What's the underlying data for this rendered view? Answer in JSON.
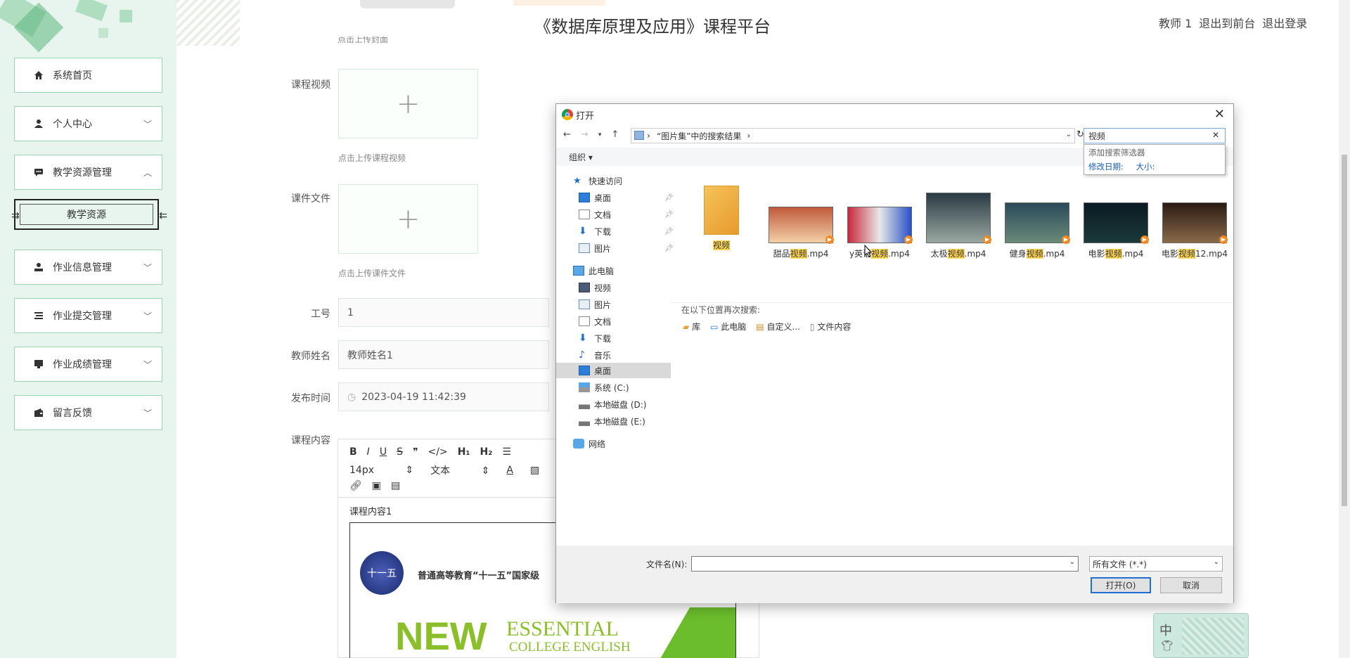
{
  "header": {
    "title": "《数据库原理及应用》课程平台",
    "user": "教师 1",
    "back_front": "退出到前台",
    "logout": "退出登录"
  },
  "sidebar": {
    "items": [
      {
        "label": "系统首页",
        "icon": "home-icon"
      },
      {
        "label": "个人中心",
        "icon": "person-icon"
      },
      {
        "label": "教学资源管理",
        "icon": "chat-icon",
        "expanded": true
      },
      {
        "label": "作业信息管理",
        "icon": "person-icon"
      },
      {
        "label": "作业提交管理",
        "icon": "list-icon"
      },
      {
        "label": "作业成绩管理",
        "icon": "monitor-icon"
      },
      {
        "label": "留言反馈",
        "icon": "wallet-icon"
      }
    ],
    "sub_item": "教学资源"
  },
  "form": {
    "video_label": "课程视频",
    "video_hint": "点击上传课程视频",
    "file_label": "课件文件",
    "file_hint": "点击上传课件文件",
    "id_label": "工号",
    "id_value": "1",
    "name_label": "教师姓名",
    "name_value": "教师姓名1",
    "time_label": "发布时间",
    "time_value": "2023-04-19 11:42:39",
    "content_label": "课程内容",
    "top_hint": "点击上传封面"
  },
  "editor": {
    "font_size": "14px",
    "block_type": "文本",
    "content_text": "课程内容1",
    "banner_text": "普通高等教育“十一五”国家级",
    "banner_badge": "十一五",
    "book_big": "NEW",
    "book_line1": "ESSENTIAL",
    "book_line2": "COLLEGE ENGLISH"
  },
  "dialog": {
    "title": "打开",
    "address": "“图片集”中的搜索结果",
    "search_value": "视频",
    "search_hint": "添加搜索筛选器",
    "filter_date": "修改日期:",
    "filter_size": "大小:",
    "organize": "组织",
    "nav": [
      "快速访问",
      "桌面",
      "文档",
      "下载",
      "图片",
      "此电脑",
      "视频",
      "图片",
      "文档",
      "下载",
      "音乐",
      "桌面",
      "系统 (C:)",
      "本地磁盘 (D:)",
      "本地磁盘 (E:)",
      "网络"
    ],
    "files": [
      {
        "pre": "",
        "hl": "视频",
        "post": ""
      },
      {
        "pre": "甜品",
        "hl": "视频",
        "post": ".mp4"
      },
      {
        "pre": "y英语",
        "hl": "视频",
        "post": ".mp4"
      },
      {
        "pre": "太极",
        "hl": "视频",
        "post": ".mp4"
      },
      {
        "pre": "健身",
        "hl": "视频",
        "post": ".mp4"
      },
      {
        "pre": "电影",
        "hl": "视频",
        "post": ".mp4"
      },
      {
        "pre": "电影",
        "hl": "视频",
        "post": "12.mp4"
      }
    ],
    "search_again": "在以下位置再次搜索:",
    "locations": [
      "库",
      "此电脑",
      "自定义...",
      "文件内容"
    ],
    "filename_label": "文件名(N):",
    "filetype": "所有文件 (*.*)",
    "open_btn": "打开(O)",
    "cancel_btn": "取消"
  },
  "ime": {
    "label": "中"
  }
}
